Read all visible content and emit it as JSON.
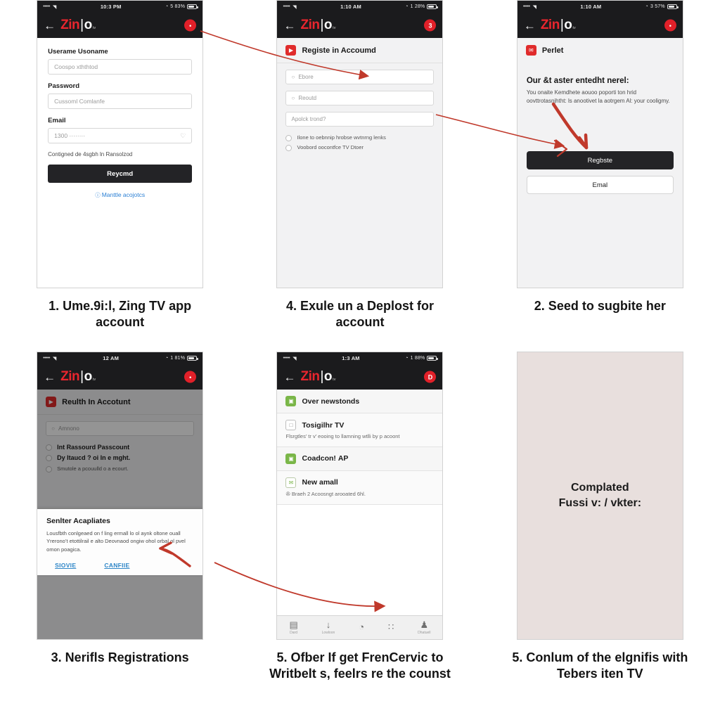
{
  "page": {
    "background": "#ffffff",
    "accent_red": "#e12029",
    "dark": "#1b1b1d",
    "link_blue": "#2a7fd4"
  },
  "brand": {
    "zin": "Zin",
    "bar": "|",
    "o": "o",
    "sub": "tv"
  },
  "icons": {
    "back": "←",
    "wifi": "●",
    "dots": "●●●●●",
    "alarm": "◔",
    "search": "○",
    "eye": "♡",
    "play": "▶",
    "mail": "✉",
    "tab_home": "▤",
    "tab_download": "↓",
    "tab_timer": "◔",
    "tab_grid": "∷",
    "tab_account": "♟"
  },
  "steps": [
    {
      "id": "step-1",
      "caption": "1. Ume.9i:l, Zing TV app account",
      "phone": {
        "status": {
          "time": "10:3 PM",
          "battery": "5 83%",
          "alarm": "◔"
        },
        "nav_badge": "•",
        "screen": "signup-form",
        "form": {
          "fields": [
            {
              "label": "Userame Usoname",
              "value": "Coospo xththtod",
              "eye": false
            },
            {
              "label": "Password",
              "value": "Cussoml Comlanfe",
              "eye": false
            },
            {
              "label": "Email",
              "value": "1300 ········",
              "eye": true
            }
          ],
          "hint": "Contigned de 4sgbh ln Ransolzod",
          "submit_label": "Reycmd",
          "link_label": "Manttle acojotcs"
        }
      }
    },
    {
      "id": "step-4",
      "caption": "4. Exule un a Deplost for account",
      "phone": {
        "status": {
          "time": "1:10 AM",
          "battery": "1 28%",
          "alarm": "◔"
        },
        "nav_badge": "3",
        "screen": "register-account",
        "section_title": "Registe in Accoumd",
        "rows": [
          {
            "text": "Ebore",
            "mag": true
          },
          {
            "text": "Reoutd",
            "mag": true
          },
          {
            "text": "Apolck trond?",
            "mag": false
          }
        ],
        "radios": [
          {
            "text": "Ilone to oebnnip hrobse wvtnrng lenks"
          },
          {
            "text": "Voobord oocontfce TV Dtoer"
          }
        ]
      }
    },
    {
      "id": "step-2",
      "caption": "2. Seed to sugbite her",
      "phone": {
        "status": {
          "time": "1:10 AM",
          "battery": "3 57%",
          "alarm": "◔"
        },
        "nav_badge": "•",
        "screen": "permission-prompt",
        "section_title": "Perlet",
        "prompt_title": "Our &t aster entedht nerel:",
        "prompt_body": "You onaite Kemdhete aouoo poporti ton hrid oovttrotasnjhtht: ls anootivet la aotrgem Al: your cooligmy.",
        "primary_label": "Regbste",
        "secondary_label": "Emal"
      }
    },
    {
      "id": "step-3",
      "caption": "3. Nerifls Registrations",
      "phone": {
        "status": {
          "time": "12 AM",
          "battery": "1 81%",
          "alarm": "◔"
        },
        "nav_badge": "•",
        "screen": "confirm-dialog",
        "section_title": "Reulth In Accotunt",
        "search_row": "Amnono",
        "radios": [
          {
            "text": "Int Rassourd Passcount",
            "bold": true
          },
          {
            "text": "Dy ltaucd ? oi ln e mght.",
            "bold": true
          },
          {
            "text": "Smutole a pcouulld o a ecourt.",
            "bold": false
          }
        ],
        "dialog": {
          "title": "Senlter Acapliates",
          "text": "Lousfbth conlgeaed on f ling ermall lo ol aynk oltone ouall Yrerono’t etottilrail e alto Deovnaod ongiw ohol orbal ol pvel omon poagica.",
          "left_button": "SIOVIE",
          "right_button": "CANFIIE"
        }
      }
    },
    {
      "id": "step-5a",
      "caption": "5. Ofber If get FrenCervic to Writbelt s, feelrs re the counst",
      "phone": {
        "status": {
          "time": "1:3 AM",
          "battery": "1 88%",
          "alarm": "◔"
        },
        "nav_badge": "D",
        "screen": "settings-list",
        "list": [
          {
            "icon": "sq-green",
            "glyph": "▣",
            "title": "Over newstonds",
            "sub": ""
          },
          {
            "icon": "sq-white",
            "glyph": "□",
            "title": "Tosigilhr TV",
            "sub": "Flsrgtles’ tr v’ eooing to llamning wtlli by p acoont"
          },
          {
            "icon": "sq-green",
            "glyph": "▣",
            "title": "Coadcon! ΑΡ",
            "sub": ""
          },
          {
            "icon": "sq-outline",
            "glyph": "✉",
            "title": "New amall",
            "sub": "✇ Braeh 2 Acoosngt arooated 6hl."
          }
        ],
        "tabs": [
          {
            "icon": "tab_home",
            "label": "Dard"
          },
          {
            "icon": "tab_download",
            "label": "Lowloon"
          },
          {
            "icon": "tab_timer",
            "label": ""
          },
          {
            "icon": "tab_grid",
            "label": ""
          },
          {
            "icon": "tab_account",
            "label": "Dhatuell"
          }
        ]
      }
    },
    {
      "id": "step-5b",
      "caption": "5. Conlum of the elgnifis with Tebers iten TV",
      "phone": {
        "screen": "completed-placeholder",
        "completed_line1": "Complated",
        "completed_line2": "Fussi v: / vkter:"
      }
    }
  ]
}
